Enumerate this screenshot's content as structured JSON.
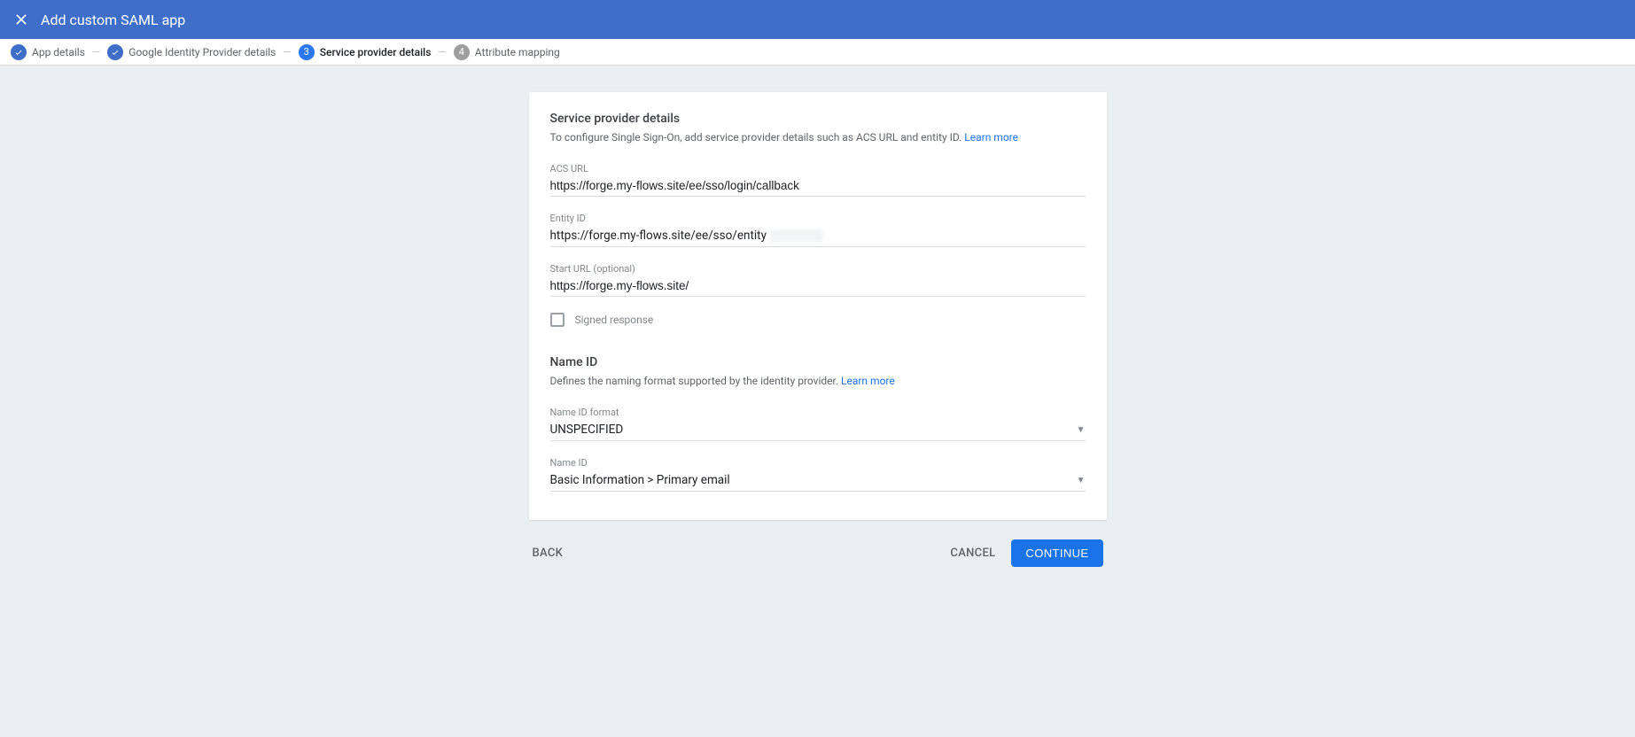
{
  "header": {
    "title": "Add custom SAML app"
  },
  "stepper": {
    "steps": [
      {
        "label": "App details"
      },
      {
        "label": "Google Identity Provider details"
      },
      {
        "number": "3",
        "label": "Service provider details"
      },
      {
        "number": "4",
        "label": "Attribute mapping"
      }
    ]
  },
  "spd": {
    "title": "Service provider details",
    "desc": "To configure Single Sign-On, add service provider details such as ACS URL and entity ID. ",
    "learn_more": "Learn more",
    "acs_label": "ACS URL",
    "acs_value": "https://forge.my-flows.site/ee/sso/login/callback",
    "entity_label": "Entity ID",
    "entity_value": "https://forge.my-flows.site/ee/sso/entity",
    "start_label": "Start URL (optional)",
    "start_value": "https://forge.my-flows.site/",
    "signed_label": "Signed response"
  },
  "nameid": {
    "title": "Name ID",
    "desc": "Defines the naming format supported by the identity provider. ",
    "learn_more": "Learn more",
    "format_label": "Name ID format",
    "format_value": "UNSPECIFIED",
    "nameid_label": "Name ID",
    "nameid_value": "Basic Information > Primary email"
  },
  "actions": {
    "back": "BACK",
    "cancel": "CANCEL",
    "continue": "CONTINUE"
  }
}
